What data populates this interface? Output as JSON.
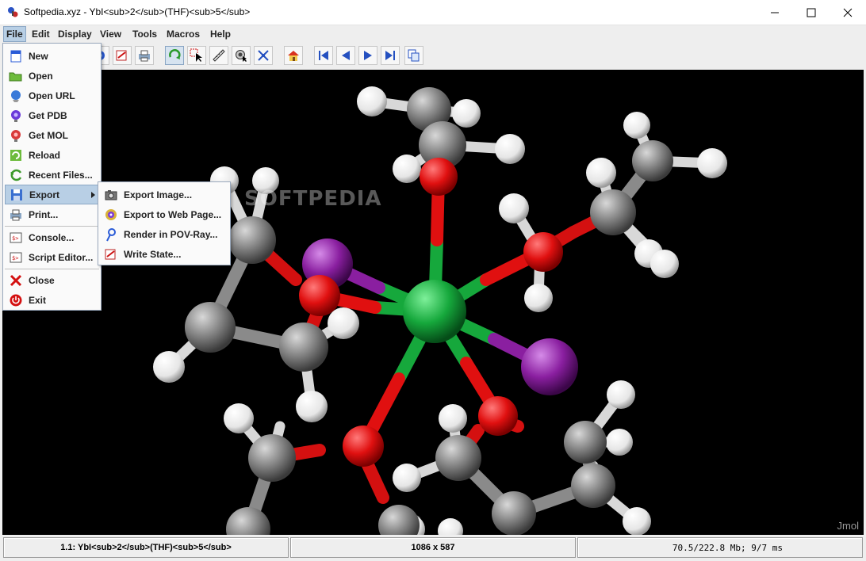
{
  "window": {
    "title": "Softpedia.xyz - YbI<sub>2</sub>(THF)<sub>5</sub>"
  },
  "menubar": {
    "items": [
      "File",
      "Edit",
      "Display",
      "View",
      "Tools",
      "Macros",
      "Help"
    ]
  },
  "file_menu": {
    "items": [
      {
        "label": "New",
        "icon": "new-icon"
      },
      {
        "label": "Open",
        "icon": "folder-icon"
      },
      {
        "label": "Open URL",
        "icon": "globe-icon"
      },
      {
        "label": "Get PDB",
        "icon": "pdb-icon"
      },
      {
        "label": "Get MOL",
        "icon": "mol-icon"
      },
      {
        "label": "Reload",
        "icon": "reload-icon"
      },
      {
        "label": "Recent Files...",
        "icon": "recent-icon"
      },
      {
        "label": "Export",
        "icon": "export-icon"
      },
      {
        "label": "Print...",
        "icon": "print-icon"
      },
      {
        "label": "Console...",
        "icon": "console-icon"
      },
      {
        "label": "Script Editor...",
        "icon": "script-icon"
      },
      {
        "label": "Close",
        "icon": "close-icon"
      },
      {
        "label": "Exit",
        "icon": "exit-icon"
      }
    ]
  },
  "export_menu": {
    "items": [
      {
        "label": "Export Image...",
        "icon": "camera-icon"
      },
      {
        "label": "Export to Web Page...",
        "icon": "web-icon"
      },
      {
        "label": "Render in POV-Ray...",
        "icon": "povray-icon"
      },
      {
        "label": "Write State...",
        "icon": "state-icon"
      }
    ]
  },
  "viewport": {
    "watermark": "SOFTPEDIA",
    "brand": "Jmol"
  },
  "statusbar": {
    "model": "1.1: YbI<sub>2</sub>(THF)<sub>5</sub>",
    "size": "1086 x 587",
    "memory": "70.5/222.8 Mb;   9/7 ms"
  },
  "colors": {
    "oxygen": "#e01010",
    "carbon": "#808080",
    "hydrogen": "#ffffff",
    "ytterbium": "#16a83c",
    "iodine": "#8a1fa0",
    "menu_highlight": "#b8cfe5"
  }
}
